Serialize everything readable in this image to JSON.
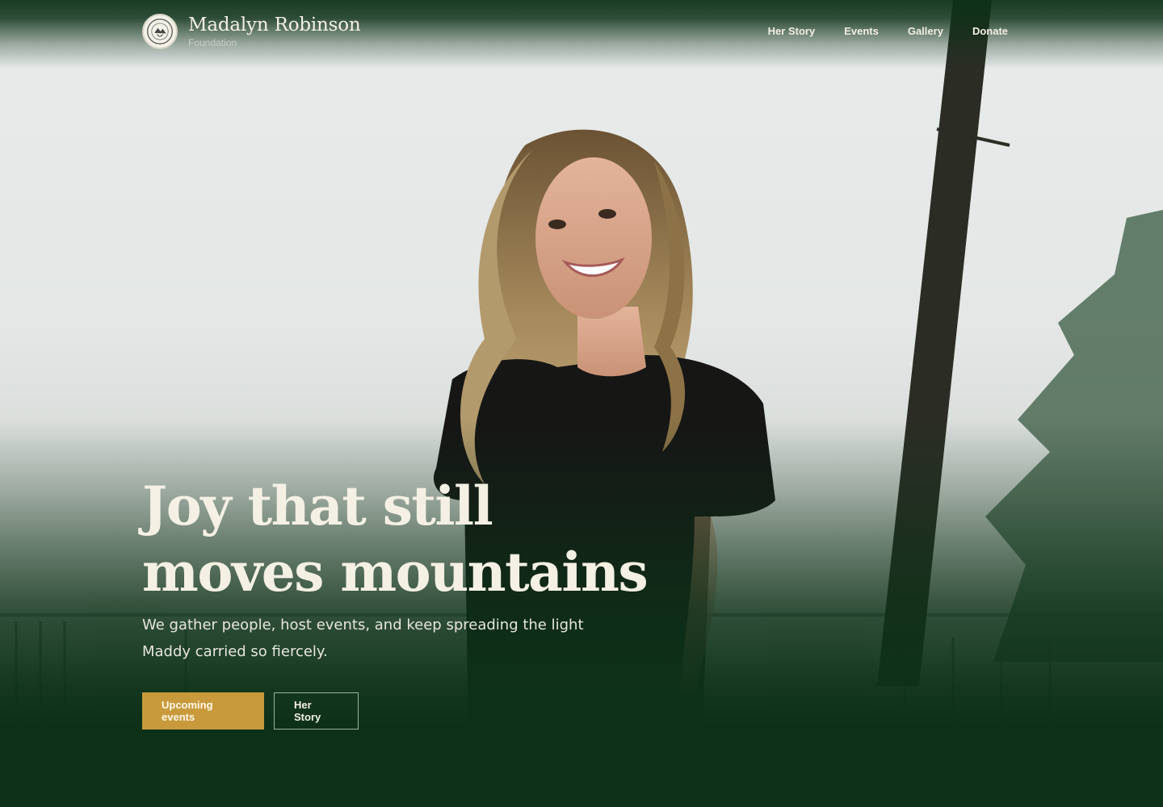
{
  "colors": {
    "brand_dark_green": "#0d3118",
    "accent_gold": "#c99a3c",
    "text_cream": "#f4f0e4"
  },
  "header": {
    "brand_name": "Madalyn Robinson",
    "brand_sub": "Foundation",
    "logo_icon": "foundation-seal-icon"
  },
  "nav": {
    "items": [
      {
        "label": "Her Story"
      },
      {
        "label": "Events"
      },
      {
        "label": "Gallery"
      },
      {
        "label": "Donate"
      }
    ]
  },
  "hero": {
    "headline_line1": "Joy that still",
    "headline_line2": "moves mountains",
    "subtext": "We gather people, host events, and keep spreading the light Maddy carried so fiercely.",
    "primary_cta": "Upcoming events",
    "secondary_cta": "Her Story"
  }
}
